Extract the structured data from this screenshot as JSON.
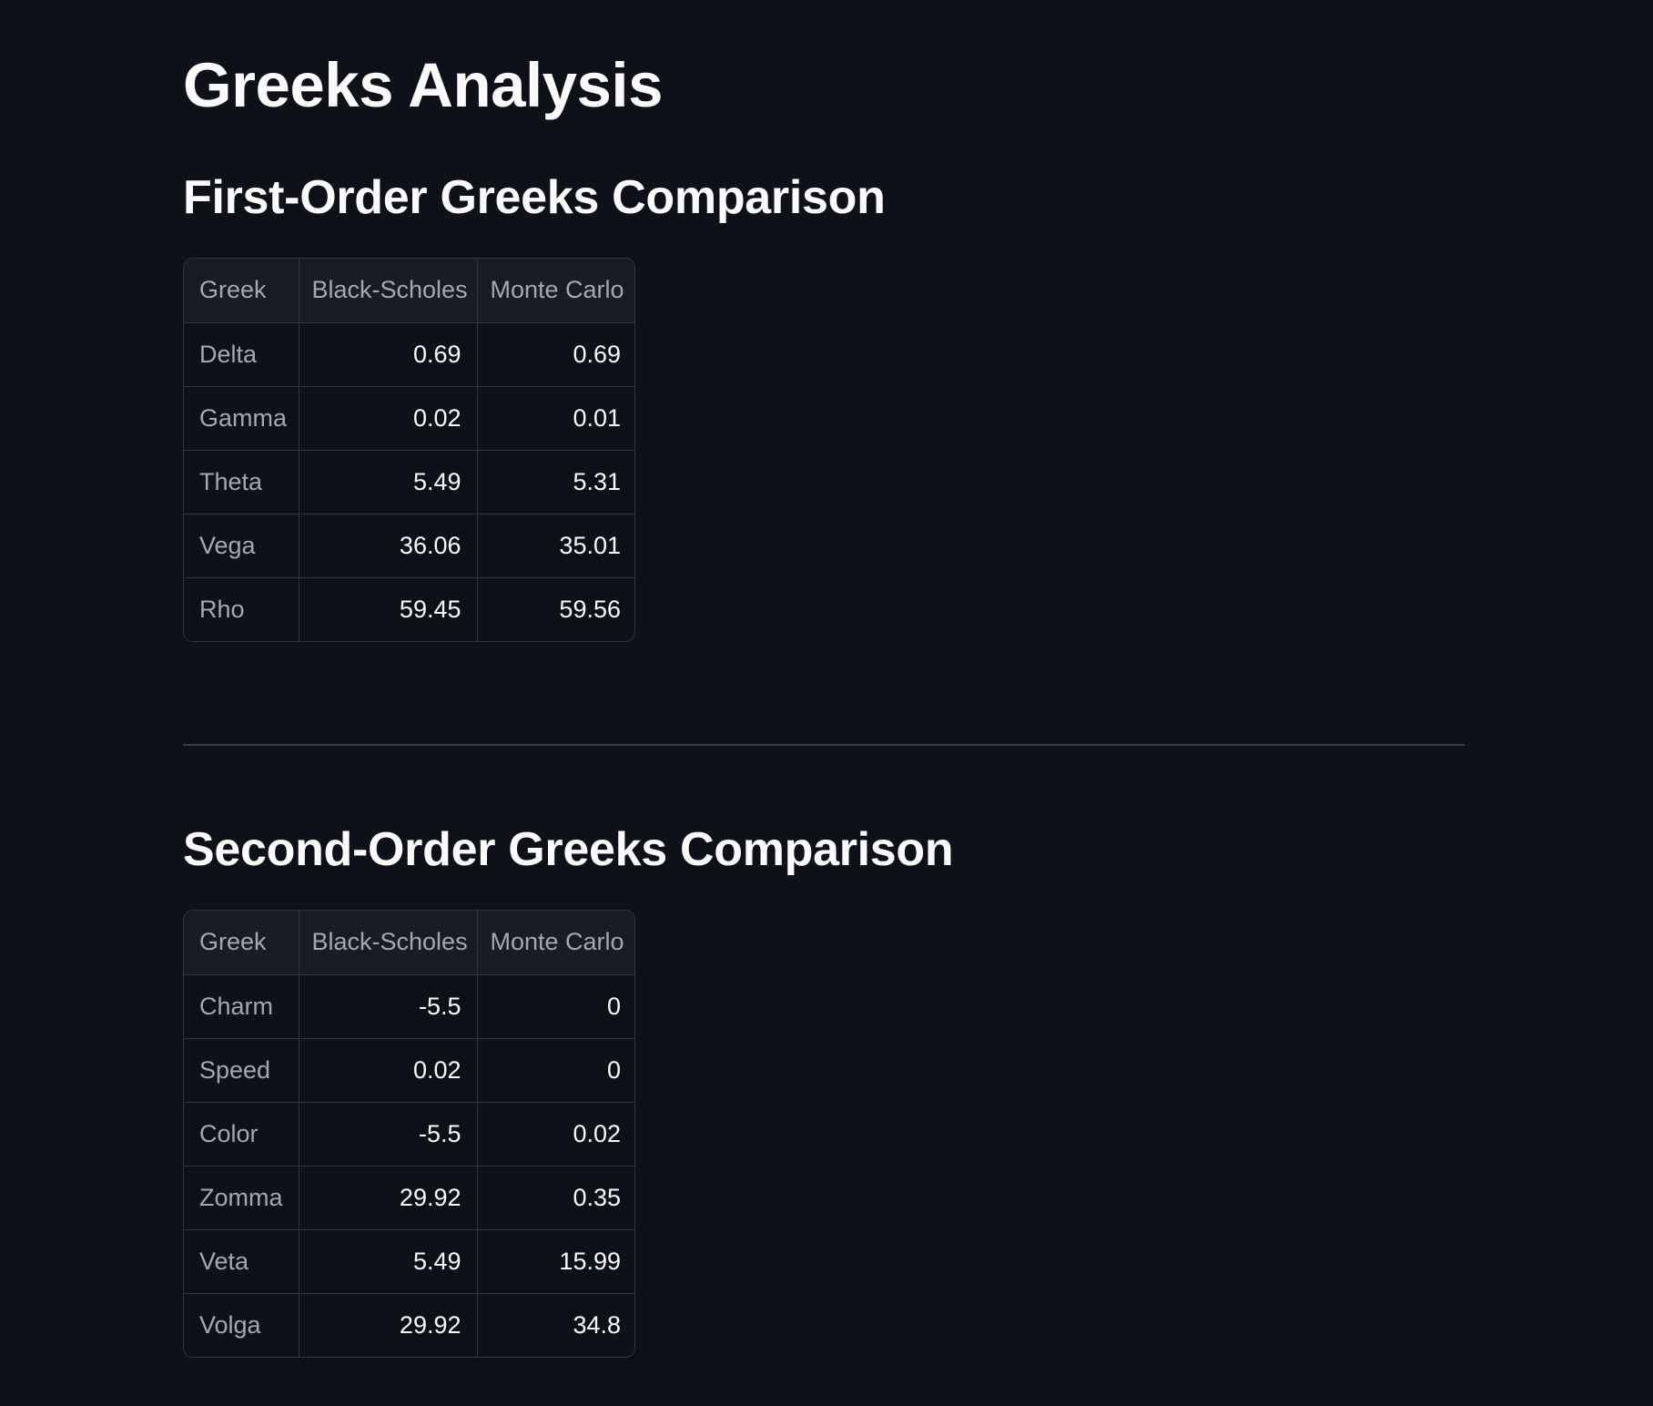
{
  "page": {
    "title": "Greeks Analysis"
  },
  "first_order": {
    "title": "First-Order Greeks Comparison",
    "columns": [
      "Greek",
      "Black-Scholes",
      "Monte Carlo"
    ],
    "rows": [
      {
        "greek": "Delta",
        "black_scholes": "0.69",
        "monte_carlo": "0.69"
      },
      {
        "greek": "Gamma",
        "black_scholes": "0.02",
        "monte_carlo": "0.01"
      },
      {
        "greek": "Theta",
        "black_scholes": "5.49",
        "monte_carlo": "5.31"
      },
      {
        "greek": "Vega",
        "black_scholes": "36.06",
        "monte_carlo": "35.01"
      },
      {
        "greek": "Rho",
        "black_scholes": "59.45",
        "monte_carlo": "59.56"
      }
    ]
  },
  "second_order": {
    "title": "Second-Order Greeks Comparison",
    "columns": [
      "Greek",
      "Black-Scholes",
      "Monte Carlo"
    ],
    "rows": [
      {
        "greek": "Charm",
        "black_scholes": "-5.5",
        "monte_carlo": "0"
      },
      {
        "greek": "Speed",
        "black_scholes": "0.02",
        "monte_carlo": "0"
      },
      {
        "greek": "Color",
        "black_scholes": "-5.5",
        "monte_carlo": "0.02"
      },
      {
        "greek": "Zomma",
        "black_scholes": "29.92",
        "monte_carlo": "0.35"
      },
      {
        "greek": "Veta",
        "black_scholes": "5.49",
        "monte_carlo": "15.99"
      },
      {
        "greek": "Volga",
        "black_scholes": "29.92",
        "monte_carlo": "34.8"
      }
    ]
  },
  "colors": {
    "background": "#0e1117",
    "text": "#fafafa",
    "muted_text": "#a3a8b4",
    "border": "#31343c",
    "header_bg": "#1a1c23"
  }
}
